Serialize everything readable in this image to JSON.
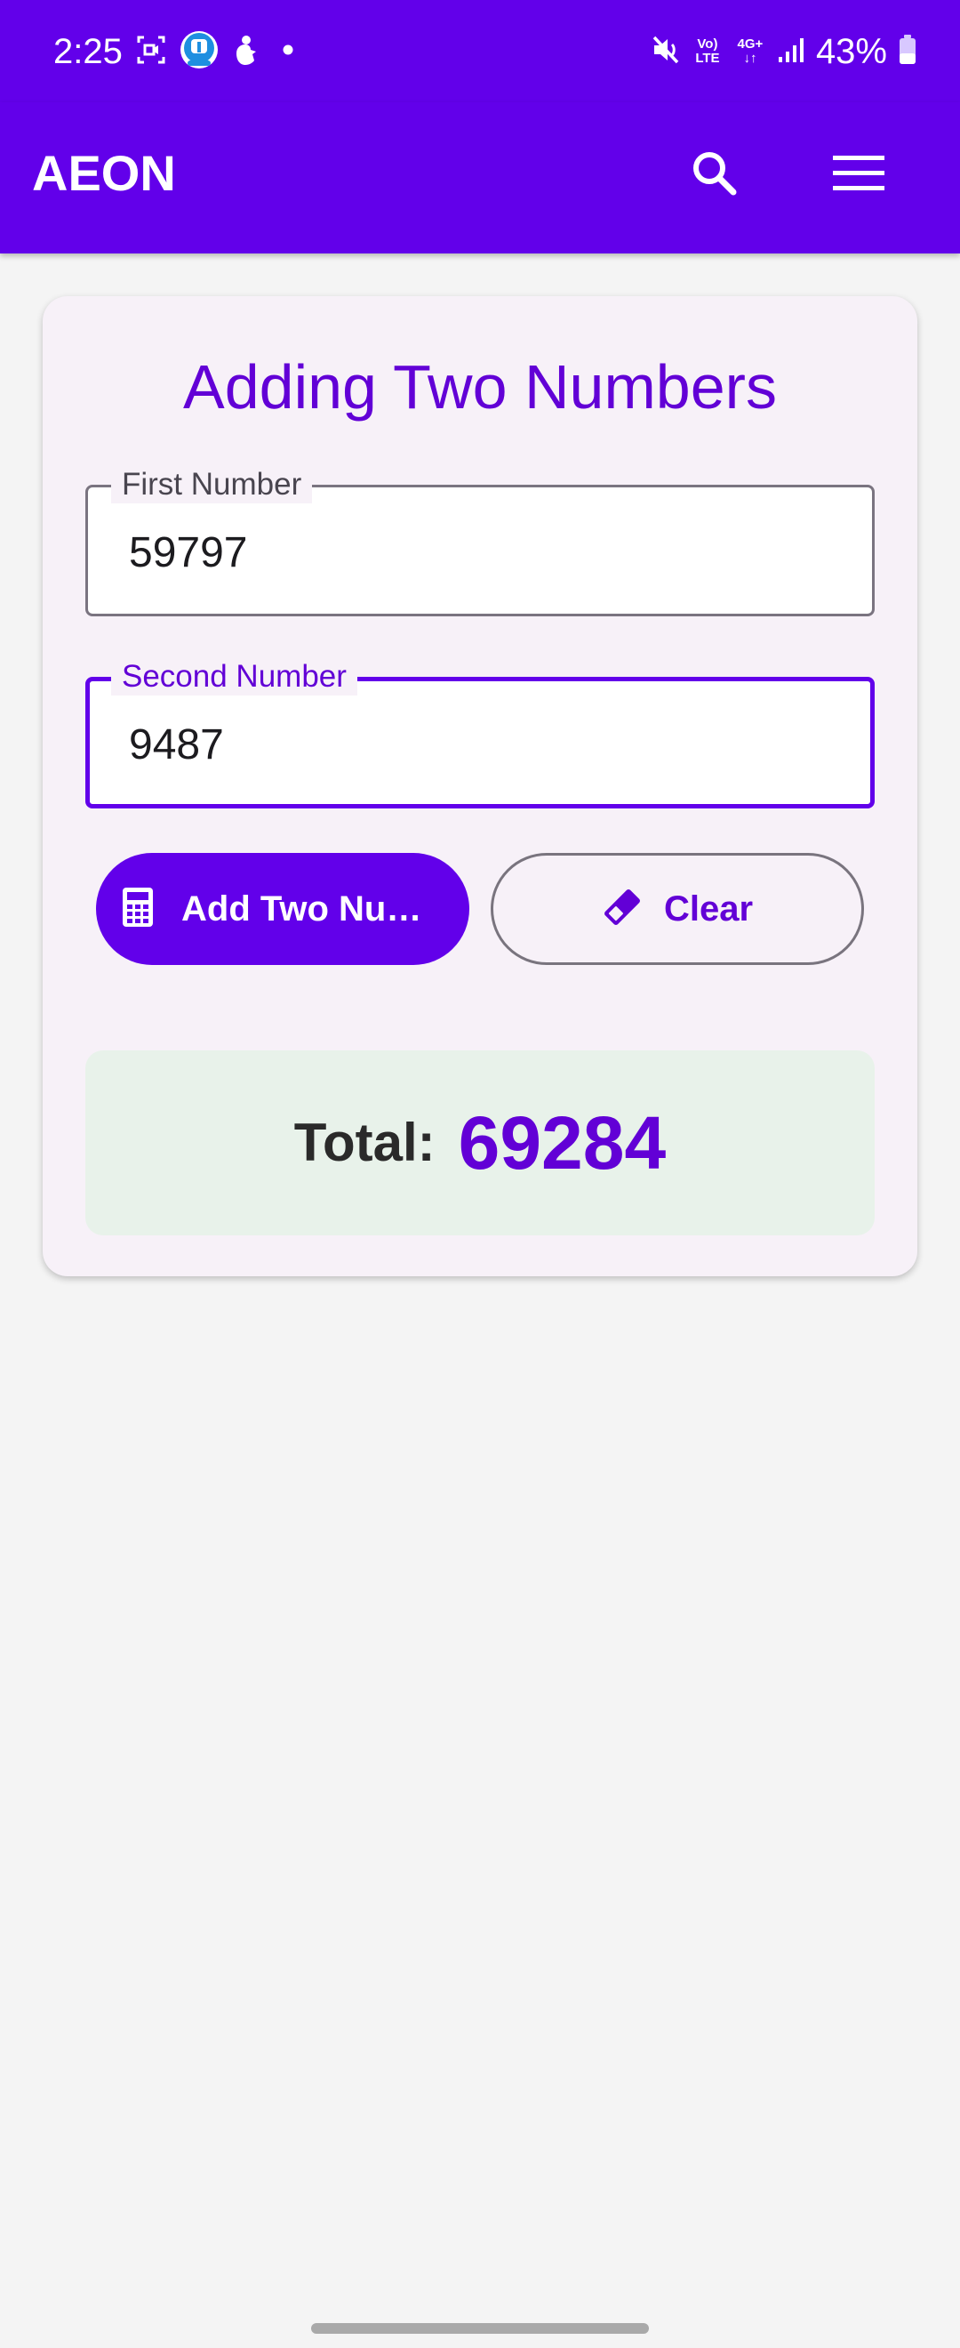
{
  "status_bar": {
    "time": "2:25",
    "battery_percent": "43%",
    "net_top": "Vo)",
    "net_bottom": "LTE",
    "net_gen_top": "4G+",
    "net_gen_bottom": "↓↑",
    "battery_level": 0.43,
    "left_icons": [
      "screen-record-icon",
      "app-notification-icon",
      "hand-icon",
      "notification-dot-icon"
    ],
    "right_icons": [
      "mute-icon",
      "volte-icon",
      "4g-plus-icon",
      "signal-icon",
      "battery-icon"
    ]
  },
  "app_bar": {
    "title": "AEON",
    "icons": [
      "search-icon",
      "menu-icon"
    ]
  },
  "card": {
    "title": "Adding Two Numbers",
    "first_field": {
      "label": "First Number",
      "value": "59797"
    },
    "second_field": {
      "label": "Second Number",
      "value": "9487"
    },
    "add_button": {
      "label": "Add Two Nu…",
      "icon": "calculator-icon"
    },
    "clear_button": {
      "label": "Clear",
      "icon": "eraser-icon"
    },
    "total": {
      "label": "Total:",
      "value": "69284"
    }
  },
  "colors": {
    "primary": "#6200ea",
    "primary_text": "#6200d6",
    "card_background": "#f7f1f8",
    "total_background": "#e8f2ea",
    "page_background": "#f4f4f4"
  }
}
